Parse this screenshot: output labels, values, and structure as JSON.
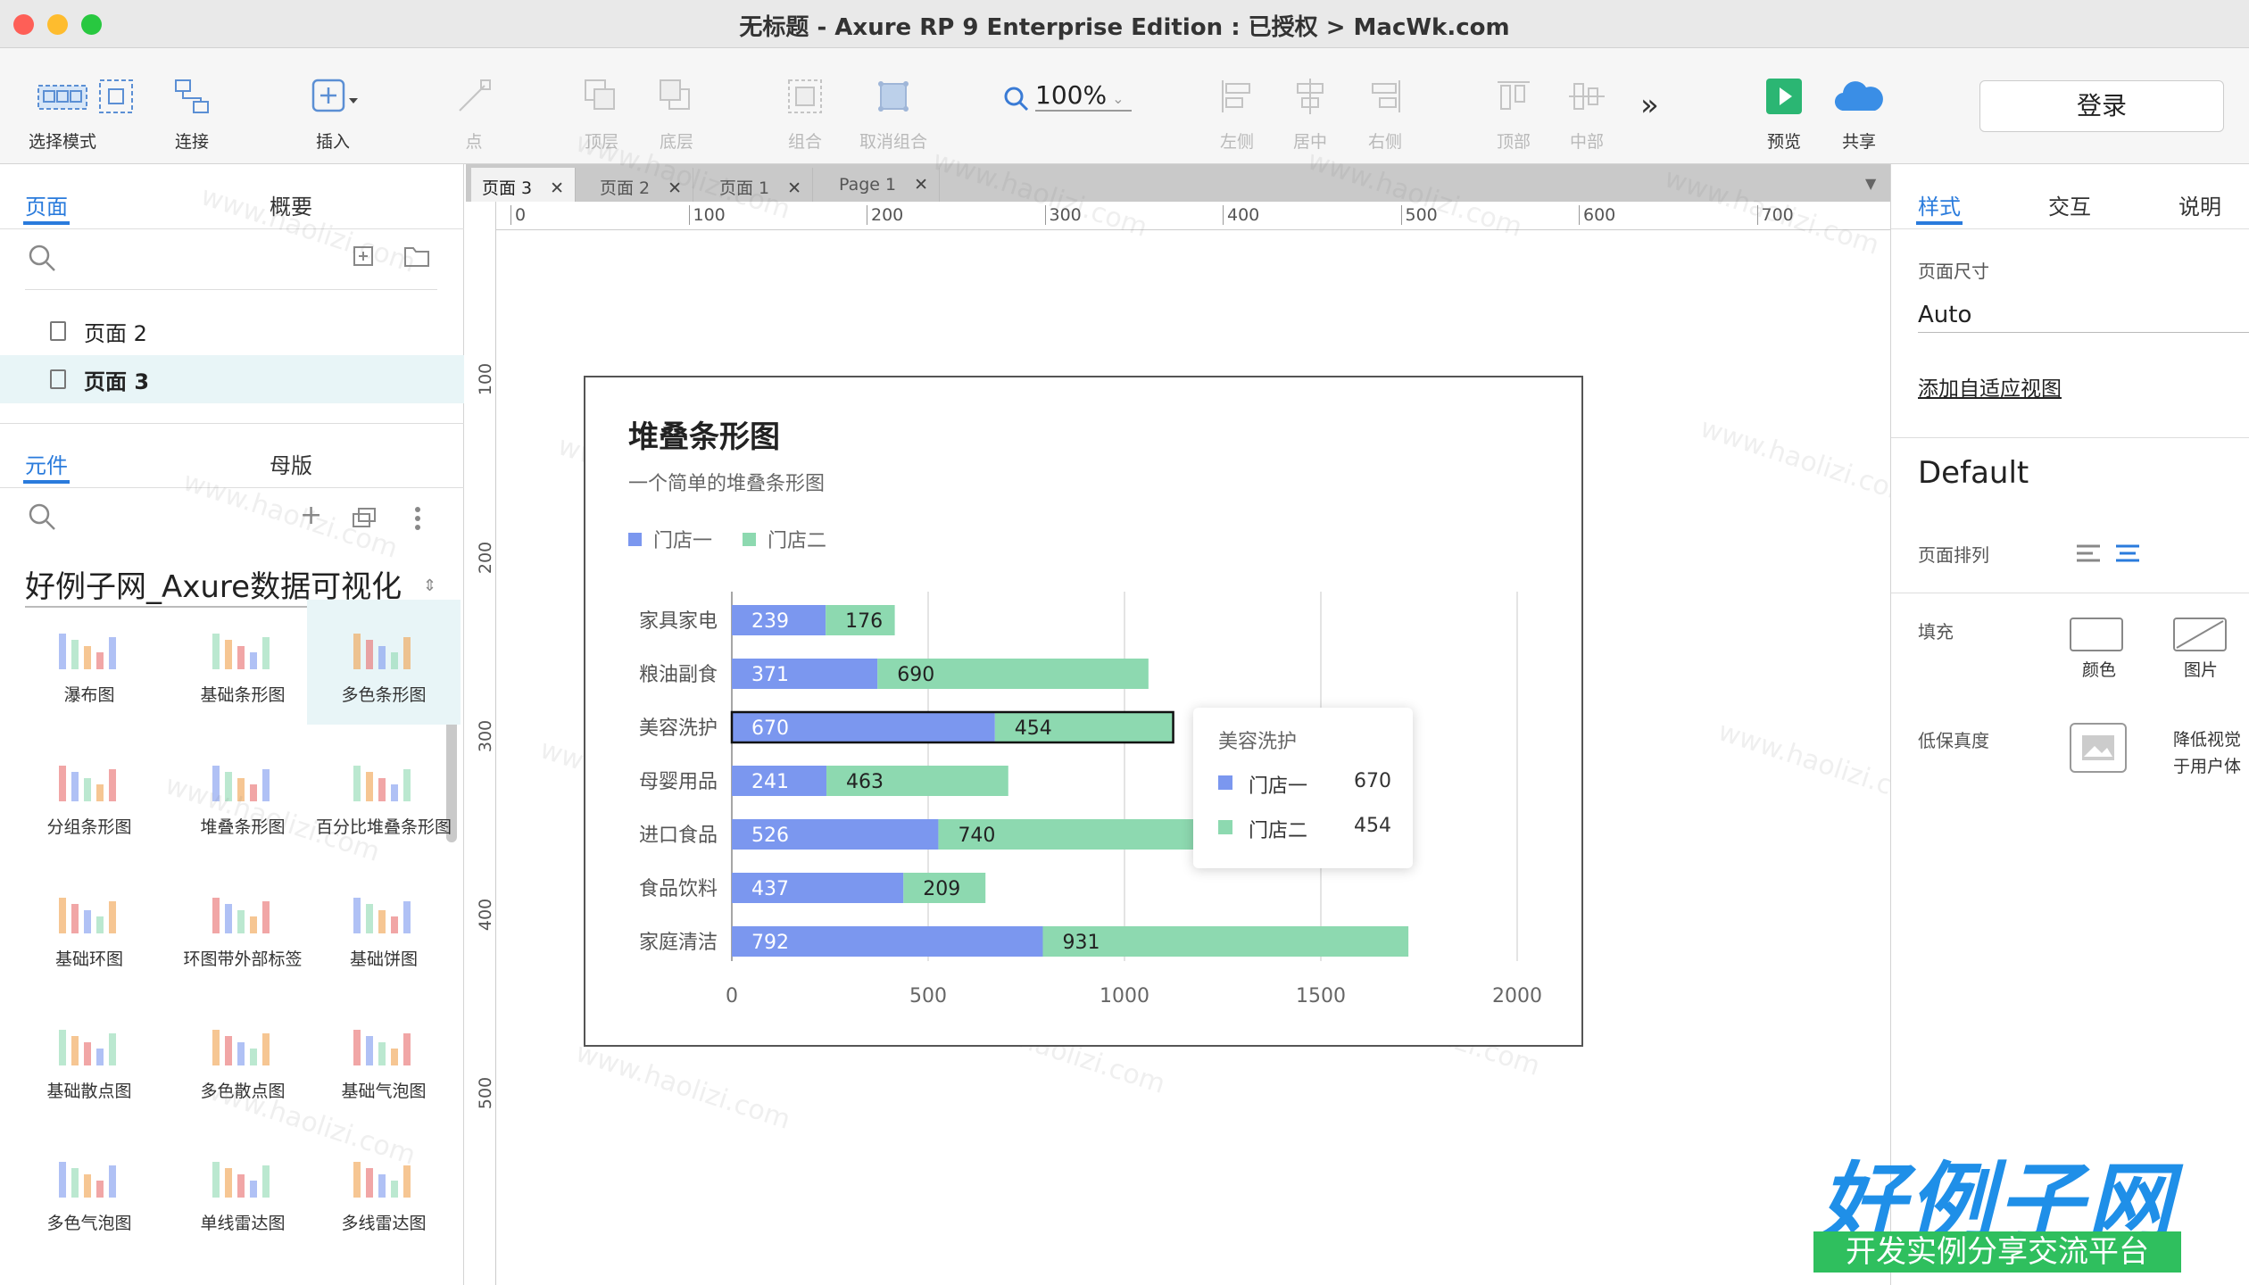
{
  "window": {
    "title": "无标题 - Axure RP 9 Enterprise Edition : 已授权 > MacWk.com"
  },
  "toolbar": {
    "select_mode": "选择模式",
    "connect": "连接",
    "insert": "插入",
    "point": "点",
    "top_layer": "顶层",
    "bottom_layer": "底层",
    "group": "组合",
    "ungroup": "取消组合",
    "zoom": "100%",
    "left": "左侧",
    "center": "居中",
    "right": "右侧",
    "top": "顶部",
    "middle": "中部",
    "preview": "预览",
    "share": "共享",
    "login": "登录"
  },
  "left_panel": {
    "tabs": {
      "pages": "页面",
      "outline": "概要"
    },
    "pages": [
      {
        "label": "页面 2"
      },
      {
        "label": "页面 3"
      }
    ],
    "lib_tabs": {
      "components": "元件",
      "masters": "母版"
    },
    "library_name": "好例子网_Axure数据可视化",
    "components": [
      {
        "label": "瀑布图"
      },
      {
        "label": "基础条形图"
      },
      {
        "label": "多色条形图"
      },
      {
        "label": "分组条形图"
      },
      {
        "label": "堆叠条形图"
      },
      {
        "label": "百分比堆叠条形图"
      },
      {
        "label": "基础环图"
      },
      {
        "label": "环图带外部标签"
      },
      {
        "label": "基础饼图"
      },
      {
        "label": "基础散点图"
      },
      {
        "label": "多色散点图"
      },
      {
        "label": "基础气泡图"
      },
      {
        "label": "多色气泡图"
      },
      {
        "label": "单线雷达图"
      },
      {
        "label": "多线雷达图"
      }
    ]
  },
  "doc_tabs": [
    {
      "label": "页面 3"
    },
    {
      "label": "页面 2"
    },
    {
      "label": "页面 1"
    },
    {
      "label": "Page 1"
    }
  ],
  "ruler": {
    "h": [
      "0",
      "100",
      "200",
      "300",
      "400",
      "500",
      "600",
      "700"
    ],
    "v": [
      "100",
      "200",
      "300",
      "400",
      "500"
    ]
  },
  "chart_data": {
    "type": "bar",
    "orientation": "horizontal",
    "stacked": true,
    "title": "堆叠条形图",
    "subtitle": "一个简单的堆叠条形图",
    "categories": [
      "家具家电",
      "粮油副食",
      "美容洗护",
      "母婴用品",
      "进口食品",
      "食品饮料",
      "家庭清洁"
    ],
    "series": [
      {
        "name": "门店一",
        "values": [
          239,
          371,
          670,
          241,
          526,
          437,
          792
        ],
        "color": "#7b97ef"
      },
      {
        "name": "门店二",
        "values": [
          176,
          690,
          454,
          463,
          740,
          209,
          931
        ],
        "color": "#8dd9b0"
      }
    ],
    "xlim": [
      0,
      2000
    ],
    "xticks": [
      "0",
      "500",
      "1000",
      "1500",
      "2000"
    ],
    "grid": true,
    "legend": "top-left",
    "highlight_index": 2
  },
  "tooltip": {
    "title": "美容洗护",
    "rows": [
      {
        "name": "门店一",
        "value": "670"
      },
      {
        "name": "门店二",
        "value": "454"
      }
    ]
  },
  "right_panel": {
    "tabs": {
      "style": "样式",
      "interaction": "交互",
      "notes": "说明"
    },
    "page_size_label": "页面尺寸",
    "page_size_value": "Auto",
    "adaptive_link": "添加自适应视图",
    "style_name": "Default",
    "page_align_label": "页面排列",
    "fill_label": "填充",
    "color_label": "颜色",
    "image_label": "图片",
    "low_fi_label": "低保真度",
    "low_fi_desc1": "降低视觉",
    "low_fi_desc2": "于用户体"
  },
  "brand": {
    "main": "好例子网",
    "sub": "开发实例分享交流平台"
  }
}
